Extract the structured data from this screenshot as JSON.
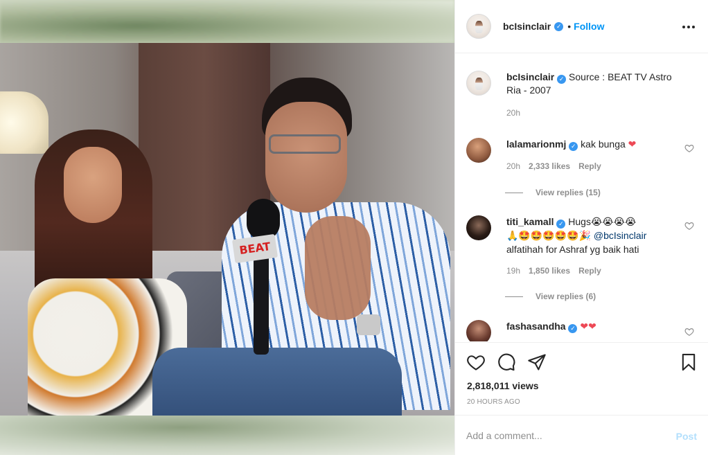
{
  "post": {
    "owner": "bcIsinclair",
    "follow_label": "Follow",
    "separator": "•",
    "caption": "Source : BEAT TV Astro Ria - 2007",
    "caption_age": "20h"
  },
  "video": {
    "mic_flag_text": "BEAT"
  },
  "comments": [
    {
      "user": "lalamarionmj",
      "verified": true,
      "text": "kak bunga",
      "emoji": "❤",
      "age": "20h",
      "likes": "2,333 likes",
      "reply_label": "Reply",
      "view_replies": "View replies (15)"
    },
    {
      "user": "titi_kamall",
      "verified": true,
      "text_start": "Hugs",
      "emoji_line1": "😭😭😭😭",
      "emoji_line2": "🙏🤩🤩🤩🤩🤩🎉",
      "mention": "@bcIsinclair",
      "text_end": "alfatihah for Ashraf yg baik hati",
      "age": "19h",
      "likes": "1,850 likes",
      "reply_label": "Reply",
      "view_replies": "View replies (6)"
    },
    {
      "user": "fashasandha",
      "verified": true,
      "emoji": "❤❤"
    }
  ],
  "stats": {
    "views": "2,818,011 views",
    "posted": "20 HOURS AGO"
  },
  "composer": {
    "placeholder": "Add a comment...",
    "post_label": "Post"
  },
  "colors": {
    "accent": "#0095f6",
    "verified": "#3897f0",
    "heart_red": "#ed4956",
    "muted": "#8e8e8e",
    "post_disabled": "#b2dffc"
  }
}
